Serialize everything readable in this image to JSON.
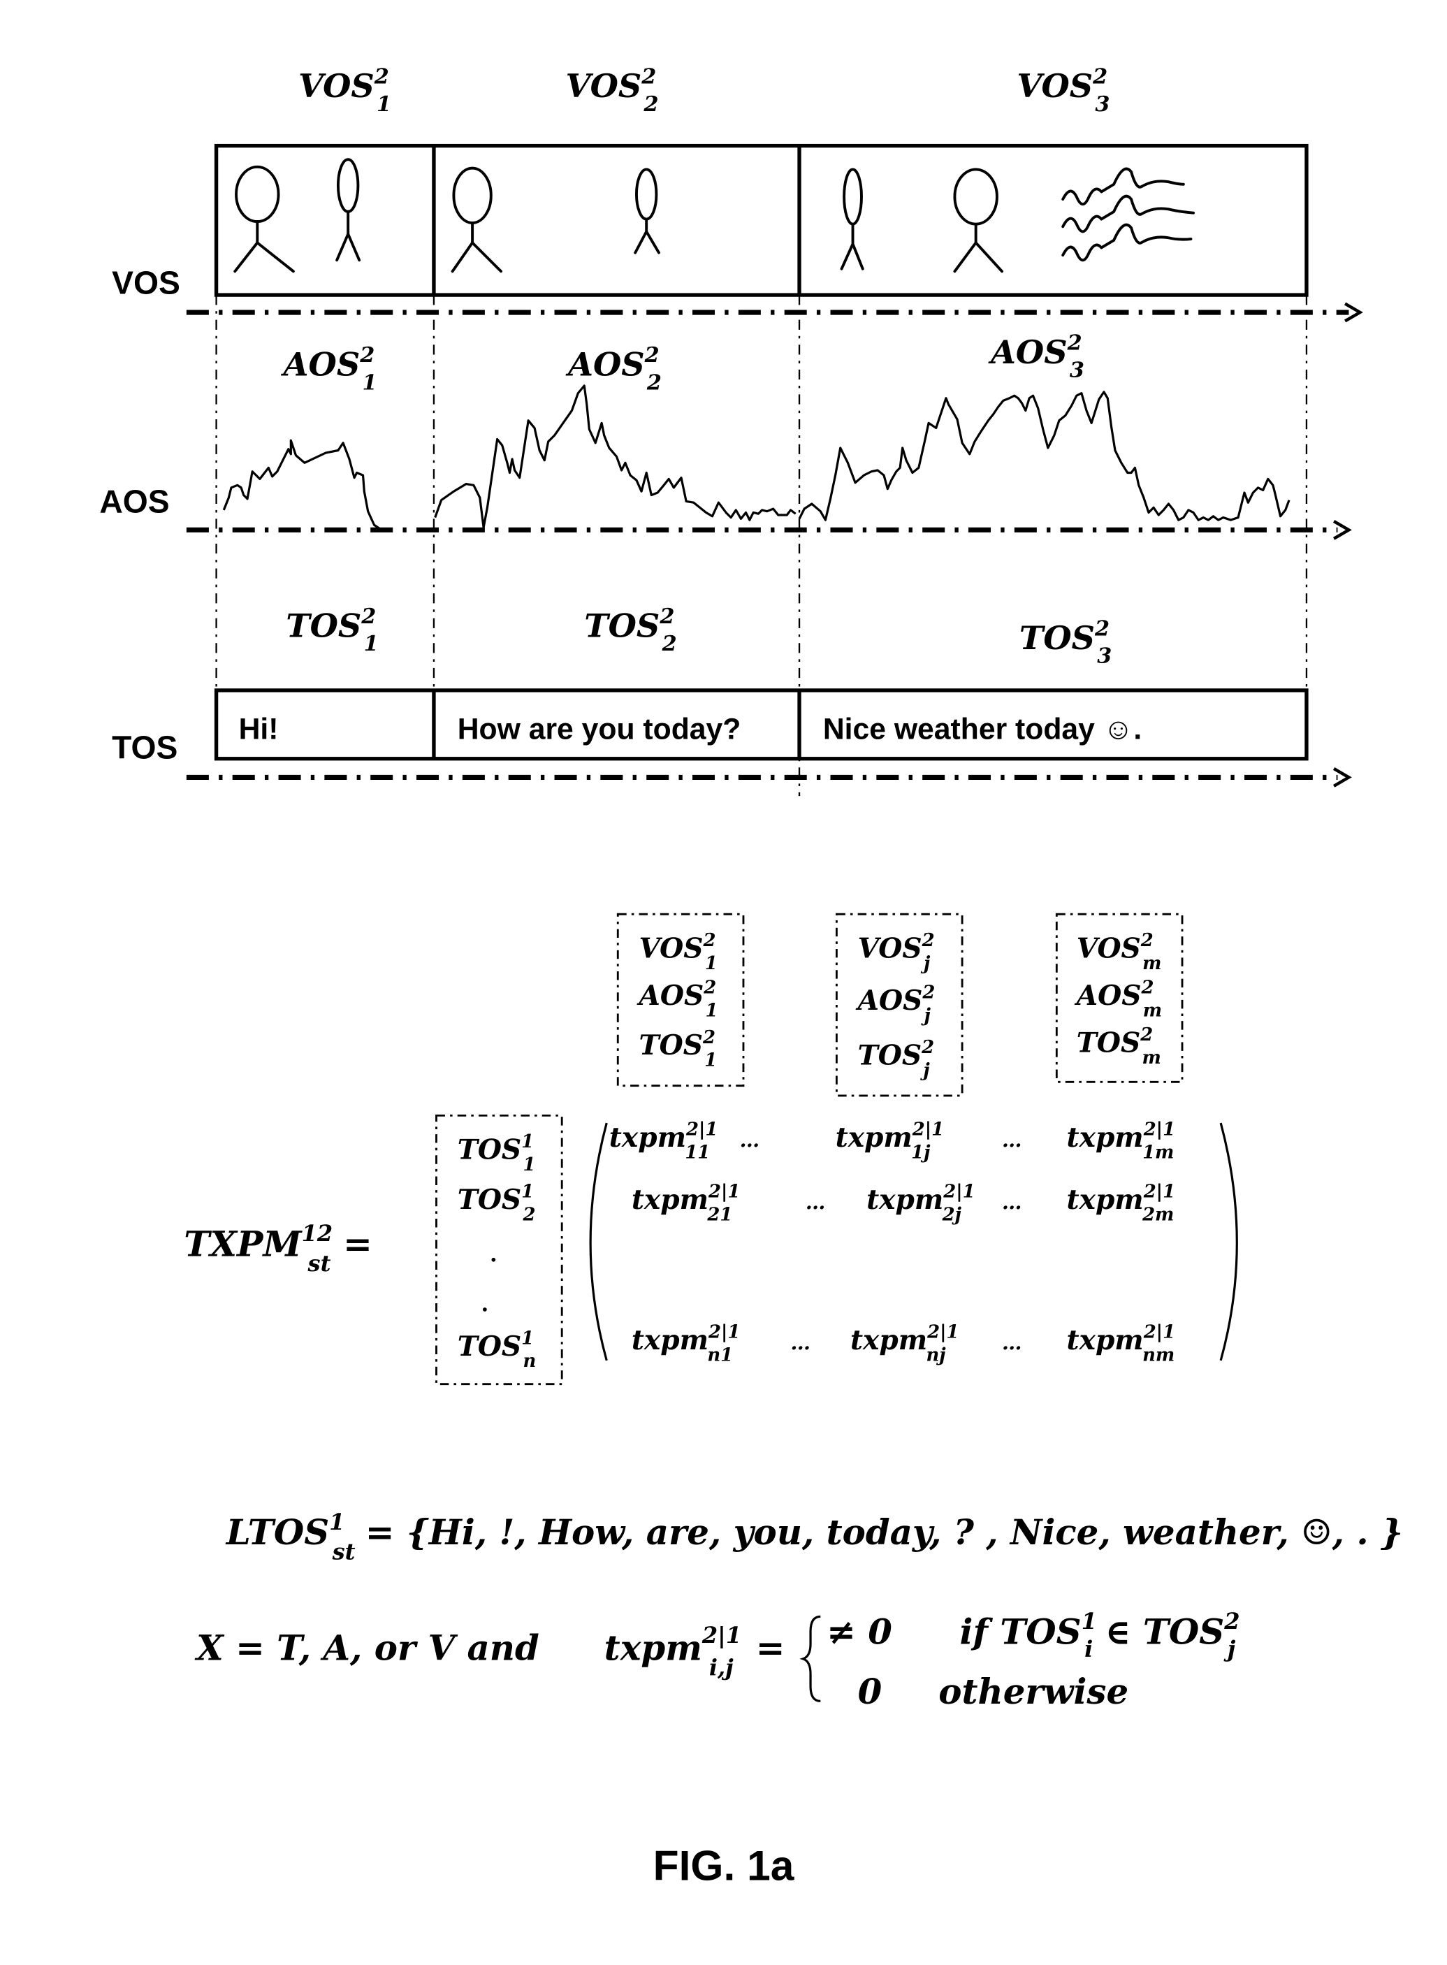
{
  "figure": {
    "caption": "FIG. 1a",
    "streams": [
      {
        "label": "VOS",
        "segment_base": "VOS",
        "segments": [
          {
            "sup": "2",
            "sub": "1"
          },
          {
            "sup": "2",
            "sub": "2"
          },
          {
            "sup": "2",
            "sub": "3"
          }
        ]
      },
      {
        "label": "AOS",
        "segment_base": "AOS",
        "segments": [
          {
            "sup": "2",
            "sub": "1"
          },
          {
            "sup": "2",
            "sub": "2"
          },
          {
            "sup": "2",
            "sub": "3"
          }
        ]
      },
      {
        "label": "TOS",
        "segment_base": "TOS",
        "segments": [
          {
            "sup": "2",
            "sub": "1"
          },
          {
            "sup": "2",
            "sub": "2"
          },
          {
            "sup": "2",
            "sub": "3"
          }
        ]
      }
    ],
    "tos_texts": [
      "Hi!",
      "How are you today?",
      "Nice weather today ☺."
    ],
    "video_content": [
      [
        "person-wide",
        "person-narrow"
      ],
      [
        "person-wide",
        "person-narrow"
      ],
      [
        "person-narrow",
        "person-wide",
        "wavy-lines"
      ]
    ]
  },
  "matrix": {
    "lhs": {
      "base": "TXPM",
      "sup": "12",
      "sub": "st",
      "eq": "="
    },
    "column_headers": [
      {
        "rows": [
          {
            "base": "VOS",
            "sup": "2",
            "sub": "1"
          },
          {
            "base": "AOS",
            "sup": "2",
            "sub": "1"
          },
          {
            "base": "TOS",
            "sup": "2",
            "sub": "1"
          }
        ]
      },
      {
        "rows": [
          {
            "base": "VOS",
            "sup": "2",
            "sub": "j"
          },
          {
            "base": "AOS",
            "sup": "2",
            "sub": "j"
          },
          {
            "base": "TOS",
            "sup": "2",
            "sub": "j"
          }
        ]
      },
      {
        "rows": [
          {
            "base": "VOS",
            "sup": "2",
            "sub": "m"
          },
          {
            "base": "AOS",
            "sup": "2",
            "sub": "m"
          },
          {
            "base": "TOS",
            "sup": "2",
            "sub": "m"
          }
        ]
      }
    ],
    "row_headers": [
      {
        "base": "TOS",
        "sup": "1",
        "sub": "1"
      },
      {
        "base": "TOS",
        "sup": "1",
        "sub": "2"
      },
      {
        "base": ".",
        "sup": "",
        "sub": ""
      },
      {
        "base": ".",
        "sup": "",
        "sub": ""
      },
      {
        "base": "TOS",
        "sup": "1",
        "sub": "n"
      }
    ],
    "ellipsis": "…",
    "cells": [
      [
        {
          "base": "txpm",
          "sup": "2|1",
          "sub": "11"
        },
        {
          "base": "txpm",
          "sup": "2|1",
          "sub": "1j"
        },
        {
          "base": "txpm",
          "sup": "2|1",
          "sub": "1m"
        }
      ],
      [
        {
          "base": "txpm",
          "sup": "2|1",
          "sub": "21"
        },
        {
          "base": "txpm",
          "sup": "2|1",
          "sub": "2j"
        },
        {
          "base": "txpm",
          "sup": "2|1",
          "sub": "2m"
        }
      ],
      [
        {
          "base": "txpm",
          "sup": "2|1",
          "sub": "n1"
        },
        {
          "base": "txpm",
          "sup": "2|1",
          "sub": "nj"
        },
        {
          "base": "txpm",
          "sup": "2|1",
          "sub": "nm"
        }
      ]
    ]
  },
  "ltos": {
    "base": "LTOS",
    "sup": "1",
    "sub": "st",
    "rhs": "= {Hi, !, How, are, you, today, ? , Nice, weather, ☺, . }"
  },
  "definition": {
    "left": "X = T, A, or V  and",
    "lhs": {
      "base": "txpm",
      "sup": "2|1",
      "sub": "i,j"
    },
    "eq": "=",
    "case1_value": "≠ 0",
    "case1_cond_prefix": "if ",
    "case1_a": {
      "base": "TOS",
      "sup": "1",
      "sub": "i"
    },
    "case1_in": " ∈ ",
    "case1_b": {
      "base": "TOS",
      "sup": "2",
      "sub": "j"
    },
    "case2_value": "0",
    "case2_cond": "otherwise"
  }
}
